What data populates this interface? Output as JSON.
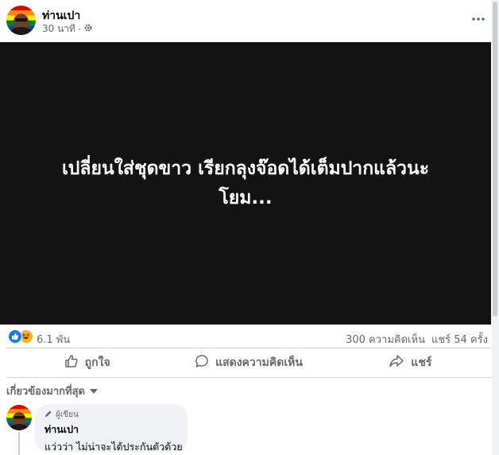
{
  "post": {
    "author": "ท่านเปา",
    "time": "30 นาที",
    "separator": "·",
    "media_text_line1": "เปลี่ยนใส่ชุดขาว เรียกลุงจ๊อดได้เต็มปากแล้วนะ",
    "media_text_line2": "โยม..."
  },
  "reactions": {
    "count": "6.1 พัน",
    "comments": "300 ความคิดเห็น",
    "shares": "แชร์ 54 ครั้ง"
  },
  "actions": {
    "like": "ถูกใจ",
    "comment": "แสดงความคิดเห็น",
    "share": "แชร์"
  },
  "sort": {
    "label": "เกี่ยวข้องมากที่สุด"
  },
  "comment": {
    "badge": "ผู้เขียน",
    "author": "ท่านเปา",
    "text": "แว่วว่า ไม่น่าจะได้ประกันตัวด้วย"
  },
  "colors": {
    "accent": "#1877f2",
    "media_bg": "#131313",
    "muted_text": "#65676b"
  },
  "icons": {
    "settings": "gear-icon",
    "more": "more-dots-icon",
    "like": "thumbs-up-icon",
    "comment": "comment-bubble-icon",
    "share": "share-arrow-icon",
    "sort": "caret-down-icon",
    "badge": "pencil-icon"
  }
}
